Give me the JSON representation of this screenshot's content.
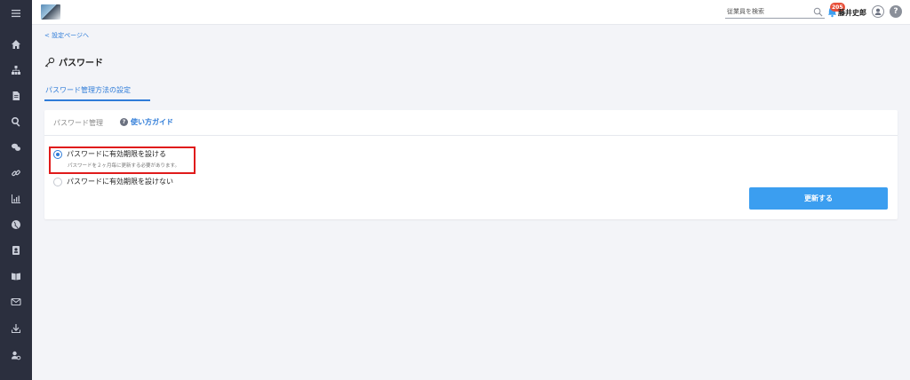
{
  "sidebar": {
    "items": [
      {
        "icon": "menu-icon"
      },
      {
        "icon": "home-icon"
      },
      {
        "icon": "org-chart-icon"
      },
      {
        "icon": "document-icon"
      },
      {
        "icon": "search-icon"
      },
      {
        "icon": "chat-icon"
      },
      {
        "icon": "link-icon"
      },
      {
        "icon": "chart-icon"
      },
      {
        "icon": "globe-icon"
      },
      {
        "icon": "contact-card-icon"
      },
      {
        "icon": "book-icon"
      },
      {
        "icon": "mail-icon"
      },
      {
        "icon": "download-icon"
      },
      {
        "icon": "user-settings-icon"
      }
    ],
    "color": "#2b2f3e"
  },
  "header": {
    "search_placeholder": "従業員を検索",
    "notification_count": "205",
    "user_name": "藤井史郎",
    "help_label": "?"
  },
  "main": {
    "back_link": "< 設定ページへ",
    "page_title": "パスワード",
    "tab_label": "パスワード管理方法の設定",
    "card": {
      "header_label": "パスワード管理",
      "guide_link": "使い方ガイド",
      "options": [
        {
          "label": "パスワードに有効期限を設ける",
          "checked": true
        },
        {
          "label": "パスワードに有効期限を設けない",
          "checked": false
        }
      ],
      "option_note": "パスワードを２ヶ月毎に更新する必要があります。",
      "submit_label": "更新する"
    }
  },
  "colors": {
    "accent": "#2f7cd8",
    "button": "#3b9ef0",
    "highlight": "#e01b1b",
    "badge": "#e8503a"
  }
}
